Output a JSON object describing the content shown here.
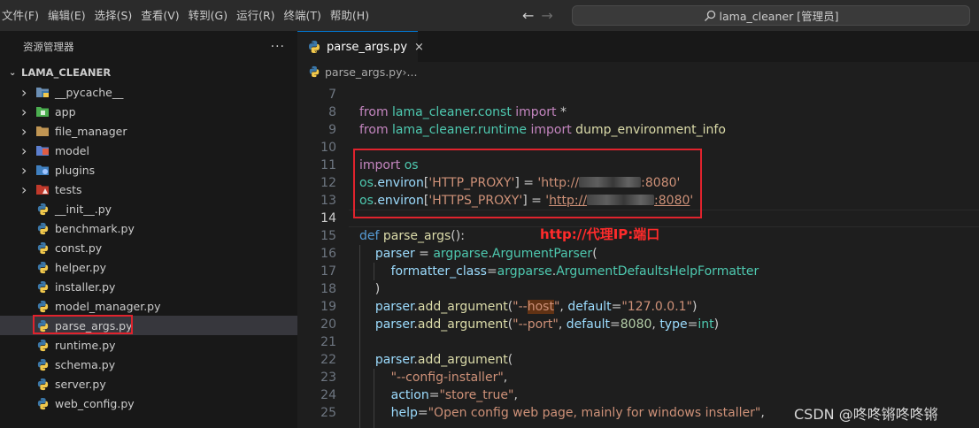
{
  "menu": [
    "文件(F)",
    "编辑(E)",
    "选择(S)",
    "查看(V)",
    "转到(G)",
    "运行(R)",
    "终端(T)",
    "帮助(H)"
  ],
  "search": {
    "text": "lama_cleaner [管理员]"
  },
  "sidebar": {
    "title": "资源管理器",
    "more": "···",
    "root": "LAMA_CLEANER",
    "items": [
      {
        "label": "__pycache__",
        "icon": "pycache-folder-icon",
        "folder": true
      },
      {
        "label": "app",
        "icon": "app-folder-icon",
        "folder": true
      },
      {
        "label": "file_manager",
        "icon": "folder-icon",
        "folder": true
      },
      {
        "label": "model",
        "icon": "model-folder-icon",
        "folder": true
      },
      {
        "label": "plugins",
        "icon": "plugins-folder-icon",
        "folder": true
      },
      {
        "label": "tests",
        "icon": "tests-folder-icon",
        "folder": true
      },
      {
        "label": "__init__.py",
        "icon": "python-icon",
        "folder": false
      },
      {
        "label": "benchmark.py",
        "icon": "python-icon",
        "folder": false
      },
      {
        "label": "const.py",
        "icon": "python-icon",
        "folder": false
      },
      {
        "label": "helper.py",
        "icon": "python-icon",
        "folder": false
      },
      {
        "label": "installer.py",
        "icon": "python-icon",
        "folder": false
      },
      {
        "label": "model_manager.py",
        "icon": "python-icon",
        "folder": false
      },
      {
        "label": "parse_args.py",
        "icon": "python-icon",
        "folder": false,
        "selected": true
      },
      {
        "label": "runtime.py",
        "icon": "python-icon",
        "folder": false
      },
      {
        "label": "schema.py",
        "icon": "python-icon",
        "folder": false
      },
      {
        "label": "server.py",
        "icon": "python-icon",
        "folder": false
      },
      {
        "label": "web_config.py",
        "icon": "python-icon",
        "folder": false
      }
    ]
  },
  "tab": {
    "label": "parse_args.py",
    "close": "×"
  },
  "breadcrumb": {
    "file": "parse_args.py",
    "sep": " › ",
    "more": "..."
  },
  "code": [
    {
      "n": "7",
      "t": []
    },
    {
      "n": "8",
      "t": [
        [
          "kw",
          "from "
        ],
        [
          "mod",
          "lama_cleaner"
        ],
        [
          "pl",
          "."
        ],
        [
          "mod",
          "const"
        ],
        [
          "kw",
          " import"
        ],
        [
          "pl",
          " *"
        ]
      ]
    },
    {
      "n": "9",
      "t": [
        [
          "kw",
          "from "
        ],
        [
          "mod",
          "lama_cleaner"
        ],
        [
          "pl",
          "."
        ],
        [
          "mod",
          "runtime"
        ],
        [
          "kw",
          " import"
        ],
        [
          "fn",
          " dump_environment_info"
        ]
      ]
    },
    {
      "n": "10",
      "t": []
    },
    {
      "n": "11",
      "t": [
        [
          "kw",
          "import "
        ],
        [
          "mod",
          "os"
        ]
      ]
    },
    {
      "n": "12",
      "t": [
        [
          "mod",
          "os"
        ],
        [
          "pl",
          "."
        ],
        [
          "vr",
          "environ"
        ],
        [
          "pl",
          "["
        ],
        [
          "st",
          "'HTTP_PROXY'"
        ],
        [
          "pl",
          "] = "
        ],
        [
          "st",
          "'http://"
        ],
        [
          "blur",
          "70"
        ],
        [
          "st",
          ":8080'"
        ]
      ]
    },
    {
      "n": "13",
      "t": [
        [
          "mod",
          "os"
        ],
        [
          "pl",
          "."
        ],
        [
          "vr",
          "environ"
        ],
        [
          "pl",
          "["
        ],
        [
          "st",
          "'HTTPS_PROXY'"
        ],
        [
          "pl",
          "] = "
        ],
        [
          "st",
          "'"
        ],
        [
          "stul",
          "http://"
        ],
        [
          "blur",
          "76"
        ],
        [
          "stul",
          ":8080"
        ],
        [
          "st",
          "'"
        ]
      ]
    },
    {
      "n": "14",
      "t": [],
      "current": true
    },
    {
      "n": "15",
      "t": [
        [
          "kw2",
          "def "
        ],
        [
          "fn",
          "parse_args"
        ],
        [
          "pl",
          "():"
        ]
      ]
    },
    {
      "n": "16",
      "t": [
        [
          "pl",
          "    "
        ],
        [
          "vr",
          "parser"
        ],
        [
          "pl",
          " = "
        ],
        [
          "mod",
          "argparse"
        ],
        [
          "pl",
          "."
        ],
        [
          "cl",
          "ArgumentParser"
        ],
        [
          "pl",
          "("
        ]
      ]
    },
    {
      "n": "17",
      "t": [
        [
          "pl",
          "        "
        ],
        [
          "vr",
          "formatter_class"
        ],
        [
          "pl",
          "="
        ],
        [
          "mod",
          "argparse"
        ],
        [
          "pl",
          "."
        ],
        [
          "cl",
          "ArgumentDefaultsHelpFormatter"
        ]
      ]
    },
    {
      "n": "18",
      "t": [
        [
          "pl",
          "    )"
        ]
      ]
    },
    {
      "n": "19",
      "t": [
        [
          "pl",
          "    "
        ],
        [
          "vr",
          "parser"
        ],
        [
          "pl",
          "."
        ],
        [
          "fn",
          "add_argument"
        ],
        [
          "pl",
          "("
        ],
        [
          "st",
          "\"--"
        ],
        [
          "sthl",
          "host"
        ],
        [
          "st",
          "\""
        ],
        [
          "pl",
          ", "
        ],
        [
          "vr",
          "default"
        ],
        [
          "pl",
          "="
        ],
        [
          "st",
          "\"127.0.0.1\""
        ],
        [
          "pl",
          ")"
        ]
      ]
    },
    {
      "n": "20",
      "t": [
        [
          "pl",
          "    "
        ],
        [
          "vr",
          "parser"
        ],
        [
          "pl",
          "."
        ],
        [
          "fn",
          "add_argument"
        ],
        [
          "pl",
          "("
        ],
        [
          "st",
          "\"--port\""
        ],
        [
          "pl",
          ", "
        ],
        [
          "vr",
          "default"
        ],
        [
          "pl",
          "="
        ],
        [
          "nm",
          "8080"
        ],
        [
          "pl",
          ", "
        ],
        [
          "vr",
          "type"
        ],
        [
          "pl",
          "="
        ],
        [
          "cl",
          "int"
        ],
        [
          "pl",
          ")"
        ]
      ]
    },
    {
      "n": "21",
      "t": []
    },
    {
      "n": "22",
      "t": [
        [
          "pl",
          "    "
        ],
        [
          "vr",
          "parser"
        ],
        [
          "pl",
          "."
        ],
        [
          "fn",
          "add_argument"
        ],
        [
          "pl",
          "("
        ]
      ]
    },
    {
      "n": "23",
      "t": [
        [
          "pl",
          "        "
        ],
        [
          "st",
          "\"--config-installer\""
        ],
        [
          "pl",
          ","
        ]
      ]
    },
    {
      "n": "24",
      "t": [
        [
          "pl",
          "        "
        ],
        [
          "vr",
          "action"
        ],
        [
          "pl",
          "="
        ],
        [
          "st",
          "\"store_true\""
        ],
        [
          "pl",
          ","
        ]
      ]
    },
    {
      "n": "25",
      "t": [
        [
          "pl",
          "        "
        ],
        [
          "vr",
          "help"
        ],
        [
          "pl",
          "="
        ],
        [
          "st",
          "\"Open config web page, mainly for windows installer\""
        ],
        [
          "pl",
          ","
        ]
      ]
    }
  ],
  "annotation": "http://代理IP:端口",
  "watermark": "CSDN @咚咚锵咚咚锵"
}
